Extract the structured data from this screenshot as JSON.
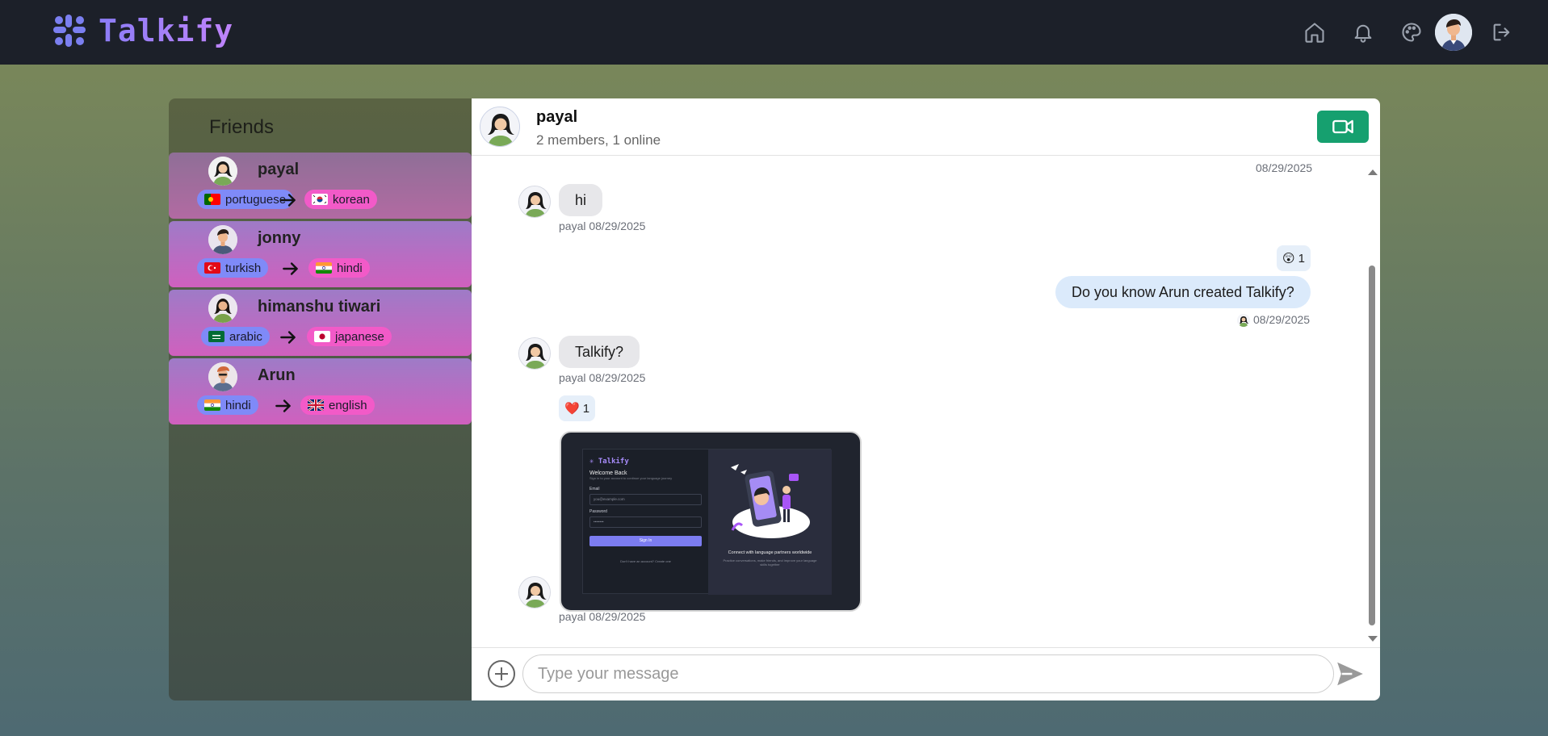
{
  "app": {
    "name": "Talkify"
  },
  "nav": {
    "icons": [
      "home-icon",
      "bell-icon",
      "palette-icon",
      "avatar",
      "logout-icon"
    ]
  },
  "sidebar": {
    "title": "Friends",
    "friends": [
      {
        "name": "payal",
        "native": "portuguese",
        "learning": "korean",
        "native_flag": "PT",
        "learning_flag": "KR"
      },
      {
        "name": "jonny",
        "native": "turkish",
        "learning": "hindi",
        "native_flag": "TR",
        "learning_flag": "IN"
      },
      {
        "name": "himanshu tiwari",
        "native": "arabic",
        "learning": "japanese",
        "native_flag": "SA",
        "learning_flag": "JP"
      },
      {
        "name": "Arun",
        "native": "hindi",
        "learning": "english",
        "native_flag": "IN",
        "learning_flag": "GB"
      }
    ]
  },
  "chat": {
    "title": "payal",
    "subtitle": "2 members, 1 online",
    "messages": [
      {
        "text": "08/29/2025"
      },
      {
        "text": "hi",
        "sender": "payal",
        "meta": "payal 08/29/2025"
      },
      {
        "reaction": "😲",
        "reaction_count": "1",
        "text": "Do you know Arun created Talkify?",
        "meta": "08/29/2025"
      },
      {
        "text": "Talkify?",
        "meta": "payal 08/29/2025"
      },
      {
        "reaction": "❤️",
        "reaction_count": "1",
        "meta": "payal 08/29/2025"
      }
    ],
    "shared_image": {
      "brand": "Talkify",
      "heading": "Welcome Back",
      "subheading": "Sign in to your account to continue your language journey",
      "email_label": "Email",
      "email_value": "you@example.com",
      "password_label": "Password",
      "password_value": "••••••••",
      "button": "Sign In",
      "footer": "Don't have an account? Create one",
      "tagline": "Connect with language partners worldwide",
      "tagline_sub": "Practice conversations, make friends, and improve your language skills together"
    },
    "composer": {
      "placeholder": "Type your message"
    }
  },
  "colors": {
    "topbar": "#1c2029",
    "brand_gradient": [
      "#8b7cf6",
      "#c084fc"
    ],
    "video_button": "#16a06f",
    "native_badge": "#7f8af8",
    "learning_badge": "#f25ac8"
  }
}
